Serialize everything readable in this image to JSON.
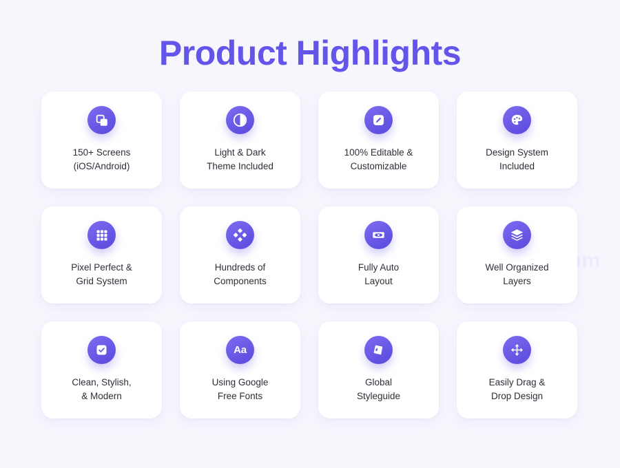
{
  "header": {
    "title": "Product Highlights",
    "title_color": "#6355ea"
  },
  "theme": {
    "background": "#f7f6fd",
    "card_background": "#ffffff",
    "accent": "#6c5ce7",
    "accent_dark": "#5a49dd",
    "text": "#2e2e38"
  },
  "watermark": {
    "text": "www.          .com"
  },
  "cards": [
    {
      "label": "150+ Screens\n(iOS/Android)",
      "icon": "copy-stack-icon"
    },
    {
      "label": "Light & Dark\nTheme Included",
      "icon": "contrast-half-circle-icon"
    },
    {
      "label": "100% Editable &\nCustomizable",
      "icon": "edit-pencil-square-icon"
    },
    {
      "label": "Design System\nIncluded",
      "icon": "paint-palette-icon"
    },
    {
      "label": "Pixel Perfect &\nGrid System",
      "icon": "grid-3x3-icon"
    },
    {
      "label": "Hundreds of\nComponents",
      "icon": "four-diamonds-component-icon"
    },
    {
      "label": "Fully Auto\nLayout",
      "icon": "auto-layout-resize-icon"
    },
    {
      "label": "Well Organized\nLayers",
      "icon": "layers-stack-icon"
    },
    {
      "label": "Clean, Stylish,\n& Modern",
      "icon": "checkbox-check-icon"
    },
    {
      "label": "Using Google\nFree Fonts",
      "icon": "typography-aa-icon",
      "icon_glyph": "Aa"
    },
    {
      "label": "Global\nStyleguide",
      "icon": "styleguide-book-icon"
    },
    {
      "label": "Easily Drag &\nDrop Design",
      "icon": "move-arrows-icon"
    }
  ]
}
